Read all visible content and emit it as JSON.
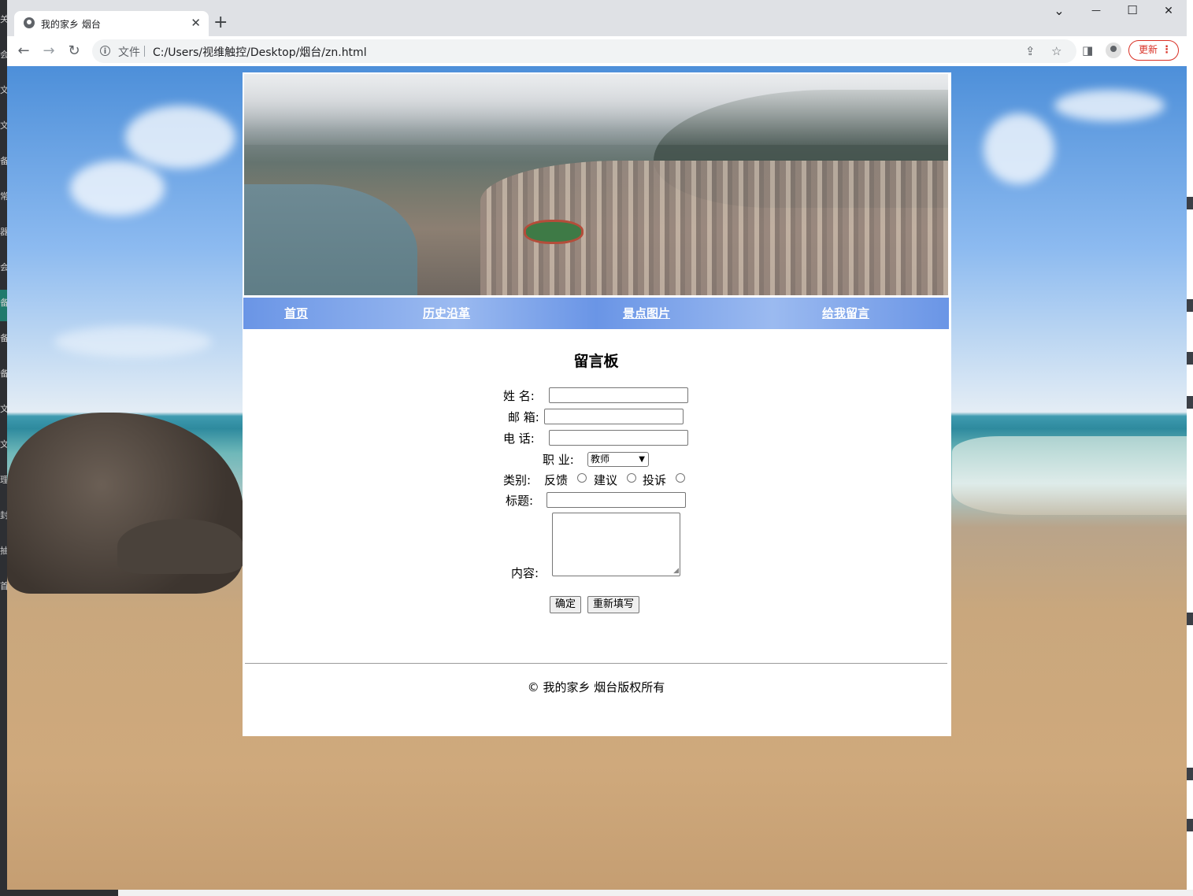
{
  "browser": {
    "tab_title": "我的家乡 烟台",
    "tab_close": "✕",
    "new_tab": "+",
    "controls": {
      "chevron": "⌄",
      "minimize": "—",
      "maximize": "☐",
      "close": "✕"
    },
    "nav": {
      "back": "←",
      "forward": "→",
      "reload": "↻"
    },
    "site_info_chip": "文件",
    "url": "C:/Users/视维触控/Desktop/烟台/zn.html",
    "update_label": "更新",
    "menu_dots": "⋮",
    "icons": [
      "info-icon",
      "share-icon",
      "star-icon",
      "sidebar-icon",
      "profile-icon"
    ]
  },
  "desktop_left_marks": [
    "关",
    "会",
    "文",
    "文",
    "备",
    "常",
    "器",
    "会",
    "备",
    "备",
    "备",
    "文",
    "文",
    "理",
    "封",
    "抽",
    "首"
  ],
  "site": {
    "nav": [
      "首页",
      "历史沿革",
      "景点图片",
      "给我留言"
    ],
    "form": {
      "title": "留言板",
      "name_label": "姓 名:",
      "email_label": "邮 箱:",
      "phone_label": "电 话:",
      "job_label": "职 业:",
      "job_selected": "教师",
      "category_label": "类别:",
      "category_options": [
        "反馈",
        "建议",
        "投诉"
      ],
      "subject_label": "标题:",
      "content_label": "内容:",
      "submit": "确定",
      "reset": "重新填写"
    },
    "footer": "© 我的家乡 烟台版权所有"
  }
}
